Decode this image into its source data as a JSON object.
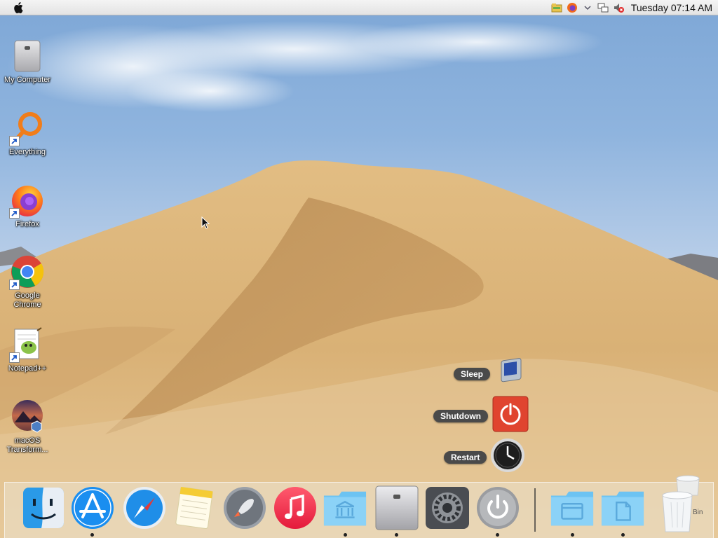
{
  "menubar": {
    "apple_icon": "apple-logo-icon",
    "tray_icons": [
      "folder-tray-icon",
      "firefox-tray-icon",
      "chevron-down-icon",
      "network-icon",
      "volume-muted-icon"
    ],
    "clock": "Tuesday 07:14 AM"
  },
  "desktop_icons": [
    {
      "label": "My Computer",
      "icon": "computer-icon"
    },
    {
      "label": "Everything",
      "icon": "everything-search-icon"
    },
    {
      "label": "Firefox",
      "icon": "firefox-icon"
    },
    {
      "label": "Google Chrome",
      "icon": "chrome-icon"
    },
    {
      "label": "Notepad++",
      "icon": "notepad-plus-plus-icon"
    },
    {
      "label": "macOS Transform...",
      "icon": "macos-transformation-icon"
    }
  ],
  "power_menu": {
    "sleep": "Sleep",
    "shutdown": "Shutdown",
    "restart": "Restart"
  },
  "dock": {
    "items": [
      {
        "name": "Finder",
        "icon": "finder-icon",
        "running": false
      },
      {
        "name": "App Store",
        "icon": "app-store-icon",
        "running": true
      },
      {
        "name": "Safari",
        "icon": "safari-icon",
        "running": false
      },
      {
        "name": "Notes",
        "icon": "notes-icon",
        "running": false
      },
      {
        "name": "Launchpad",
        "icon": "launchpad-icon",
        "running": false
      },
      {
        "name": "Music",
        "icon": "music-icon",
        "running": false
      },
      {
        "name": "Library Folder",
        "icon": "library-folder-icon",
        "running": true
      },
      {
        "name": "Computer",
        "icon": "computer-icon",
        "running": true
      },
      {
        "name": "System Preferences",
        "icon": "gear-icon",
        "running": false
      },
      {
        "name": "Power",
        "icon": "power-icon",
        "running": true
      },
      {
        "name": "Applications Folder",
        "icon": "applications-folder-icon",
        "running": true
      },
      {
        "name": "Documents Folder",
        "icon": "documents-folder-icon",
        "running": true
      },
      {
        "name": "Trash",
        "icon": "trash-icon",
        "running": false
      }
    ],
    "trash_label": "Bin"
  },
  "colors": {
    "shutdown_red": "#e0442f",
    "folder_blue": "#5ab8ee",
    "sand": "#d7b07a"
  }
}
